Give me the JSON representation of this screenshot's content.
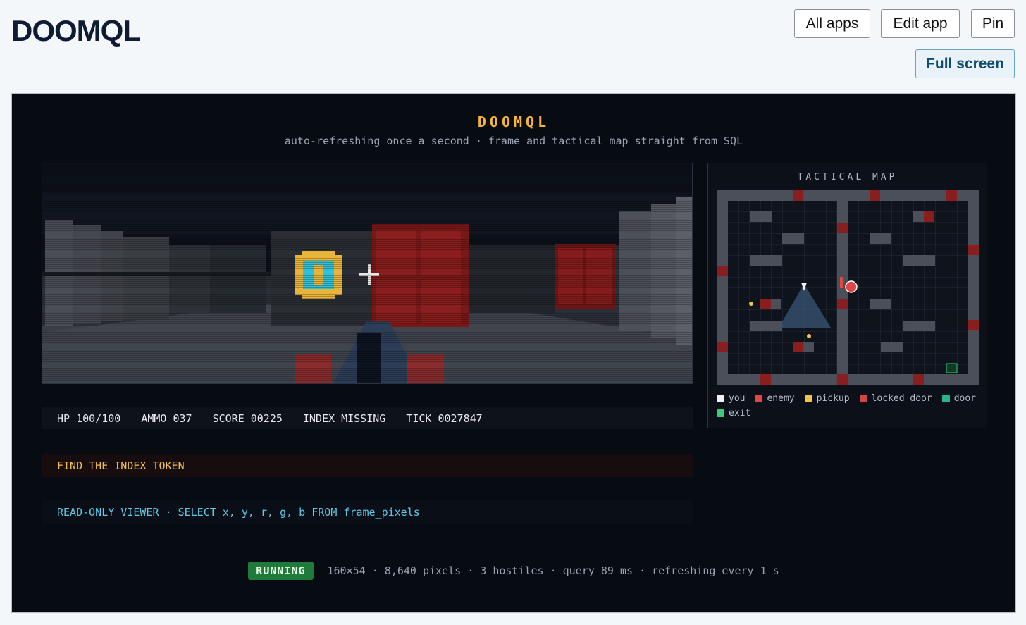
{
  "header": {
    "title": "DOOMQL",
    "buttons": {
      "all_apps": "All apps",
      "edit_app": "Edit app",
      "pin": "Pin",
      "full_screen": "Full screen"
    }
  },
  "game": {
    "title": "DOOMQL",
    "subtitle": "auto-refreshing once a second · frame and tactical map straight from SQL",
    "hud": {
      "hp": "HP 100/100",
      "ammo": "AMMO 037",
      "score": "SCORE 00225",
      "index": "INDEX MISSING",
      "tick": "TICK 0027847"
    },
    "objective": "FIND THE INDEX TOKEN",
    "sql_line": "READ-ONLY VIEWER · SELECT x, y, r, g, b FROM frame_pixels",
    "status": {
      "badge": "RUNNING",
      "info": "160×54 · 8,640 pixels · 3 hostiles · query 89 ms · refreshing every 1 s"
    },
    "tactical_map": {
      "title": "TACTICAL MAP",
      "legend": [
        {
          "label": "you",
          "color": "#f2f2f2"
        },
        {
          "label": "enemy",
          "color": "#e04848"
        },
        {
          "label": "pickup",
          "color": "#f2c14e"
        },
        {
          "label": "locked door",
          "color": "#d64545"
        },
        {
          "label": "door",
          "color": "#2bb38a"
        },
        {
          "label": "exit",
          "color": "#3ccb7a"
        }
      ]
    }
  },
  "colors": {
    "accent": "#f5b434",
    "running": "#1f7a3c",
    "sql": "#5ec8e6"
  }
}
